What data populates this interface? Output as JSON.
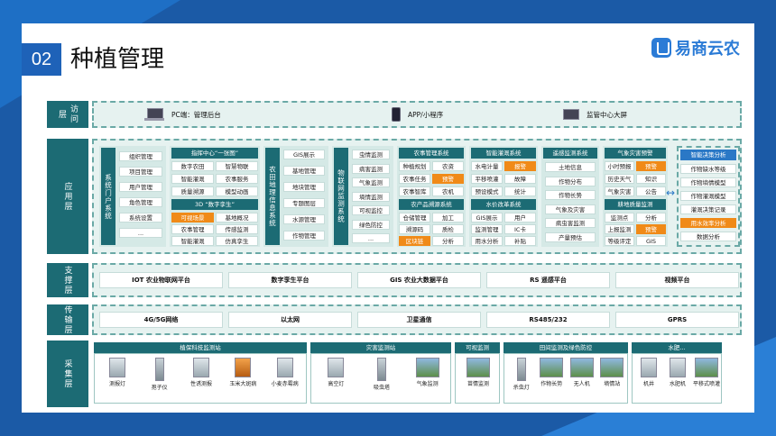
{
  "slide": {
    "number": "02",
    "title": "种植管理"
  },
  "logo": {
    "text": "易商云农",
    "icon": "logo-icon"
  },
  "layers": {
    "access": {
      "label": "访问层",
      "items": [
        {
          "icon": "laptop-icon",
          "text": "PC端：管理后台"
        },
        {
          "icon": "phone-icon",
          "text": "APP/小程序"
        },
        {
          "icon": "screen-icon",
          "text": "监管中心大屏"
        }
      ]
    },
    "app": {
      "label": "应用层",
      "portal": {
        "title": "系统门户系统",
        "items": [
          "组织管理",
          "项目管理",
          "用户管理",
          "角色管理",
          "系统设置",
          "..."
        ]
      },
      "command": {
        "header1": "指挥中心“一张图”",
        "items1": [
          "数字农田",
          "智慧物联",
          "智能灌溉",
          "农事服务",
          "质量溯源",
          "模型动画"
        ],
        "header2": "3D “数字孪生”",
        "items2": [
          "可视场景",
          "基地概况",
          "农事管理",
          "传感监测",
          "智能灌溉",
          "仿真孪生"
        ]
      },
      "gis": {
        "title": "农田地理信息系统",
        "items": [
          "GIS展示",
          "基地管理",
          "地块管理",
          "专题图层",
          "水源管理",
          "作物管理"
        ]
      },
      "iot": {
        "title": "物联网监测系统",
        "items": [
          "虫情监测",
          "病害监测",
          "气象监测",
          "墒情监测",
          "可视监控",
          "绿色防控",
          "..."
        ]
      },
      "farm": {
        "header1": "农事管理系统",
        "items1": [
          "种植规划",
          "农资",
          "农事任务",
          "预警",
          "农事智库",
          "农机"
        ],
        "header2": "农产品溯源系统",
        "items2": [
          "仓储管理",
          "加工",
          "溯源码",
          "质检",
          "区块链",
          "分析"
        ]
      },
      "irrigation": {
        "header1": "智能灌溉系统",
        "items1": [
          "水电计量",
          "报警",
          "平移喷灌",
          "故障",
          "预设模式",
          "统计"
        ],
        "header2": "水价改革系统",
        "items2": [
          "GIS展示",
          "用户",
          "监测管理",
          "IC卡",
          "用水分析",
          "补贴"
        ]
      },
      "remote": {
        "header": "遥感监测系统",
        "items": [
          "土地信息",
          "作物分布",
          "作物长势",
          "气象及灾害",
          "病虫害监测",
          "产量预估"
        ]
      },
      "disaster": {
        "header1": "气象灾害预警",
        "items1": [
          "小时预报",
          "预警",
          "历史天气",
          "知识",
          "气象灾害",
          "公告"
        ],
        "header2": "耕地质量监测",
        "items2": [
          "监测点",
          "分析",
          "上报监测",
          "预警",
          "等级评定",
          "GIS"
        ]
      },
      "decision": {
        "header": "智能决策分析",
        "items": [
          "作物缺水等级",
          "作物墒情模型",
          "作物灌溉模型",
          "灌溉决策记录",
          "用水效率分析",
          "数据分析"
        ]
      }
    },
    "support": {
      "label": "支撑层",
      "items": [
        "IOT 农业物联网平台",
        "数字孪生平台",
        "GIS 农业大数据平台",
        "RS 遥感平台",
        "视频平台"
      ]
    },
    "transport": {
      "label": "传输层",
      "items": [
        "4G/5G网络",
        "以太网",
        "卫星通信",
        "RS485/232",
        "GPRS"
      ]
    },
    "collect": {
      "label": "采集层",
      "groups": [
        {
          "title": "植保科技监测站",
          "devices": [
            "测报灯",
            "孢子仪",
            "性诱测报",
            "玉米大斑病",
            "小麦赤霉病"
          ]
        },
        {
          "title": "灾害监测站",
          "devices": [
            "高空灯",
            "吸虫塔",
            "气象监测"
          ]
        },
        {
          "title": "可视监测",
          "devices": [
            "苗情监测"
          ]
        },
        {
          "title": "田间监测及绿色防控",
          "devices": [
            "杀虫灯",
            "作物长势",
            "无人机",
            "墒情站"
          ]
        },
        {
          "title": "水肥...",
          "devices": [
            "机井",
            "水肥机",
            "平移式喷灌"
          ]
        }
      ]
    }
  },
  "colors": {
    "teal": "#1c6b74",
    "orange": "#f08a18",
    "blue": "#2a78c6",
    "bg": "#1b5aa6"
  }
}
